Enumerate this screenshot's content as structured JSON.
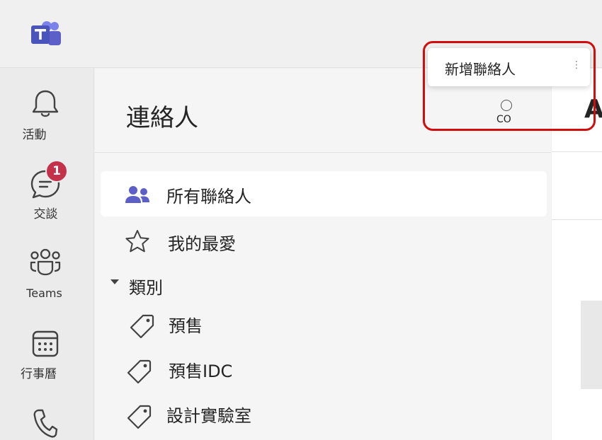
{
  "rail": {
    "items": [
      {
        "label": "活動",
        "icon": "bell-icon"
      },
      {
        "label": "交談",
        "icon": "chat-icon",
        "badge": "1"
      },
      {
        "label": "Teams",
        "icon": "teams-icon"
      },
      {
        "label": "行事曆",
        "icon": "calendar-icon"
      },
      {
        "label": "",
        "icon": "phone-icon"
      }
    ]
  },
  "contacts": {
    "title": "連絡人",
    "co_label": "CO",
    "items": [
      {
        "label": "所有聯絡人",
        "icon": "people-icon",
        "selected": true
      },
      {
        "label": "我的最愛",
        "icon": "star-icon"
      }
    ],
    "category_header": "類別",
    "categories": [
      {
        "label": "預售",
        "icon": "tag-icon"
      },
      {
        "label": "預售IDC",
        "icon": "tag-icon"
      },
      {
        "label": "設計實驗室",
        "icon": "tag-icon"
      }
    ]
  },
  "right_panel": {
    "peek_text": "A"
  },
  "menu": {
    "add_contact_label": "新增聯絡人"
  },
  "colors": {
    "accent": "#5b5fc7",
    "badge": "#c4314b",
    "highlight": "#d10d0d"
  }
}
